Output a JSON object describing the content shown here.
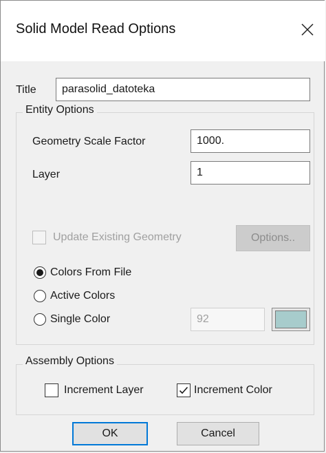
{
  "window": {
    "title": "Solid Model Read Options"
  },
  "title_field": {
    "label": "Title",
    "value": "parasolid_datoteka"
  },
  "entity_options": {
    "group_label": "Entity Options",
    "geometry_scale_factor": {
      "label": "Geometry Scale Factor",
      "value": "1000."
    },
    "layer": {
      "label": "Layer",
      "value": "1"
    },
    "update_existing_geometry": {
      "label": "Update Existing Geometry",
      "checked": false,
      "enabled": false
    },
    "options_button": "Options..",
    "color_mode": {
      "selected": "colors_from_file",
      "colors_from_file": "Colors From File",
      "active_colors": "Active Colors",
      "single_color": "Single Color"
    },
    "single_color_value": "92",
    "swatch_color": "#a7cccc"
  },
  "assembly_options": {
    "group_label": "Assembly Options",
    "increment_layer": {
      "label": "Increment Layer",
      "checked": false
    },
    "increment_color": {
      "label": "Increment Color",
      "checked": true
    }
  },
  "buttons": {
    "ok": "OK",
    "cancel": "Cancel"
  },
  "icons": {
    "close": "close-icon",
    "check": "checkmark-icon"
  }
}
